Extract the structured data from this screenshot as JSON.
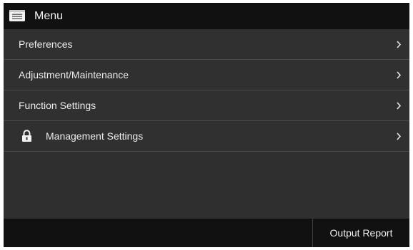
{
  "header": {
    "icon": "menu-list-icon",
    "title": "Menu"
  },
  "menu": {
    "items": [
      {
        "label": "Preferences",
        "icon": "chevron-right-icon"
      },
      {
        "label": "Adjustment/Maintenance",
        "icon": "chevron-right-icon"
      },
      {
        "label": "Function Settings",
        "icon": "chevron-right-icon"
      },
      {
        "label": "Management Settings",
        "leading_icon": "lock-icon",
        "icon": "chevron-right-icon"
      }
    ]
  },
  "footer": {
    "output_report_label": "Output Report"
  },
  "colors": {
    "bar_background": "#111111",
    "list_background": "#303030",
    "separator": "#4a4a4a",
    "text": "#ececec"
  }
}
